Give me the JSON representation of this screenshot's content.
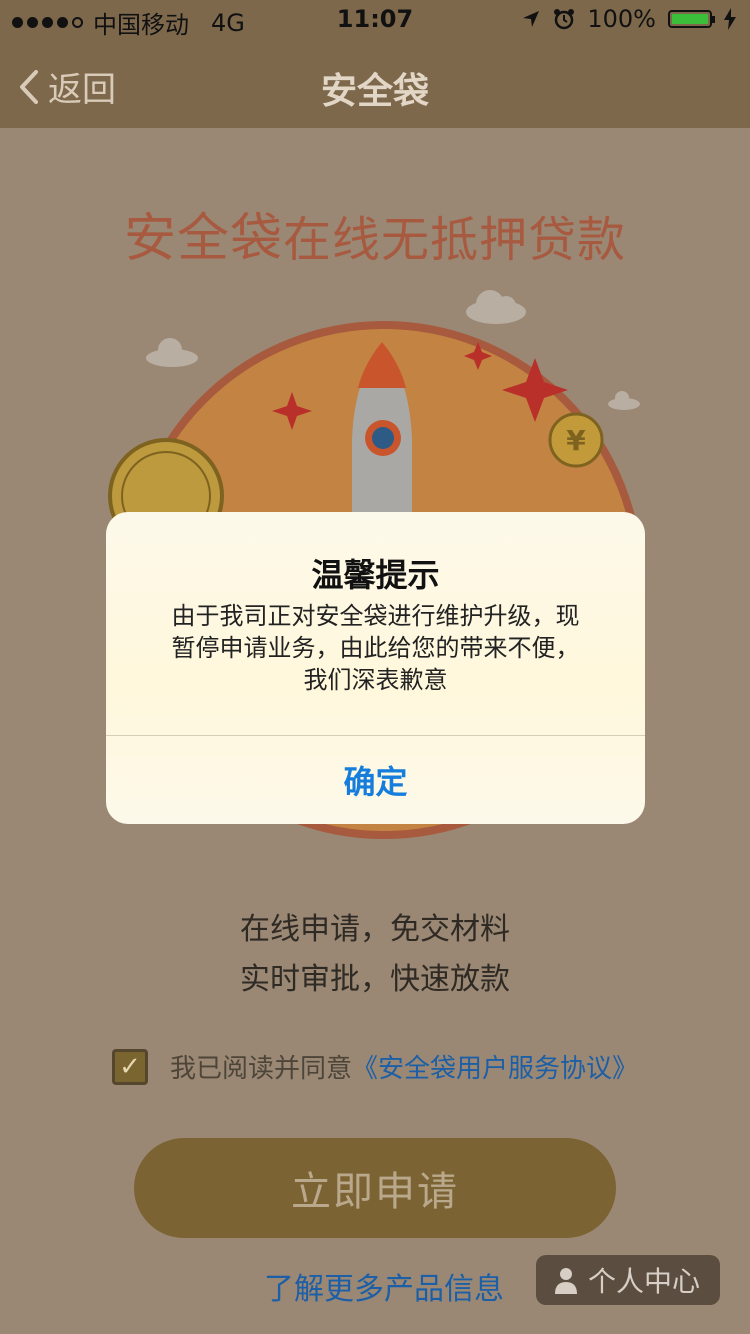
{
  "status_bar": {
    "carrier": "中国移动",
    "network": "4G",
    "time": "11:07",
    "battery": "100%",
    "battery_level": 1.0
  },
  "nav": {
    "back_label": "返回",
    "title": "安全袋"
  },
  "main": {
    "headline_brand": "安全袋",
    "headline_rest": "在线无抵押贷款",
    "features": [
      "在线申请，免交材料",
      "实时审批，快速放款"
    ],
    "agreement_text": "我已阅读并同意",
    "agreement_link": "《安全袋用户服务协议》",
    "apply_button": "立即申请",
    "more_info_link": "了解更多产品信息"
  },
  "personal_center": "个人中心",
  "dialog": {
    "title": "温馨提示",
    "message_lines": [
      "由于我司正对安全袋进行维护升级，现",
      "暂停申请业务，由此给您的带来不便，",
      "我们深表歉意"
    ],
    "confirm": "确定"
  },
  "colors": {
    "overlay_bg": "#9a8874",
    "nav_bg": "#7d684c",
    "headline": "#a85a40",
    "link": "#1d5fa6",
    "dialog_button": "#157ddb"
  }
}
